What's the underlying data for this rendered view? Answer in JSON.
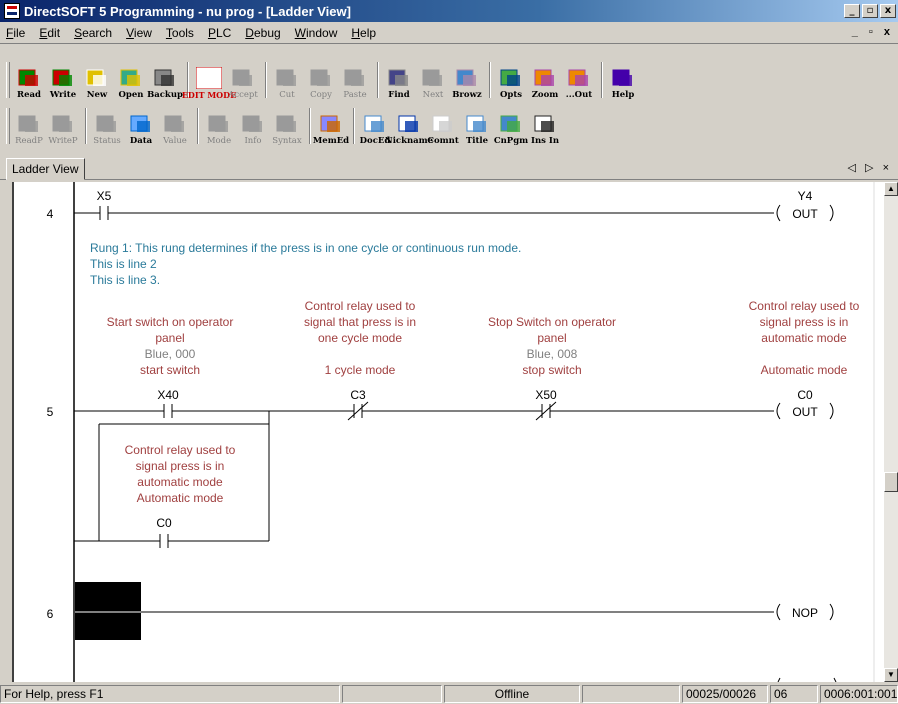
{
  "window": {
    "title": "DirectSOFT 5 Programming - nu prog - [Ladder View]",
    "min": "_",
    "max": "▫",
    "close": "x"
  },
  "menu": [
    "File",
    "Edit",
    "Search",
    "View",
    "Tools",
    "PLC",
    "Debug",
    "Window",
    "Help"
  ],
  "menu_underline": [
    "F",
    "E",
    "S",
    "V",
    "T",
    "P",
    "D",
    "W",
    "H"
  ],
  "mdi_controls": "_ ▫ x",
  "toolbar1": [
    {
      "label": "Read",
      "icon": "read-icon"
    },
    {
      "label": "Write",
      "icon": "write-icon"
    },
    {
      "label": "New",
      "icon": "new-icon"
    },
    {
      "label": "Open",
      "icon": "open-icon"
    },
    {
      "label": "Backup",
      "icon": "backup-icon"
    },
    {
      "label": "EDIT MODE",
      "icon": "edit-mode-icon"
    },
    {
      "label": "Accept",
      "icon": "accept-icon",
      "disabled": true
    },
    {
      "label": "Cut",
      "icon": "cut-icon",
      "disabled": true
    },
    {
      "label": "Copy",
      "icon": "copy-icon",
      "disabled": true
    },
    {
      "label": "Paste",
      "icon": "paste-icon",
      "disabled": true
    },
    {
      "label": "Find",
      "icon": "find-icon"
    },
    {
      "label": "Next",
      "icon": "next-icon",
      "disabled": true
    },
    {
      "label": "Browz",
      "icon": "browse-icon"
    },
    {
      "label": "Opts",
      "icon": "options-icon"
    },
    {
      "label": "Zoom",
      "icon": "zoom-icon"
    },
    {
      "label": "...Out",
      "icon": "zoom-out-icon"
    },
    {
      "label": "Help",
      "icon": "help-icon"
    }
  ],
  "toolbar2": [
    {
      "label": "ReadP",
      "icon": "read-plc-icon",
      "disabled": true
    },
    {
      "label": "WriteP",
      "icon": "write-plc-icon",
      "disabled": true
    },
    {
      "label": "Status",
      "icon": "status-icon",
      "disabled": true
    },
    {
      "label": "Data",
      "icon": "data-icon"
    },
    {
      "label": "Value",
      "icon": "value-icon",
      "disabled": true
    },
    {
      "label": "Mode",
      "icon": "mode-icon",
      "disabled": true
    },
    {
      "label": "Info",
      "icon": "info-icon",
      "disabled": true
    },
    {
      "label": "Syntax",
      "icon": "syntax-icon",
      "disabled": true
    },
    {
      "label": "MemEd",
      "icon": "memory-editor-icon"
    },
    {
      "label": "DocEd",
      "icon": "doc-editor-icon"
    },
    {
      "label": "Nickname",
      "icon": "nickname-icon"
    },
    {
      "label": "Comnt",
      "icon": "comment-icon"
    },
    {
      "label": "Title",
      "icon": "title-icon"
    },
    {
      "label": "CnPgm",
      "icon": "cnpgm-icon"
    },
    {
      "label": "Ins In",
      "icon": "insert-instruction-icon"
    }
  ],
  "tab": {
    "label": "Ladder View",
    "nav": "◁ ▷ ×"
  },
  "ladder": {
    "rung4": {
      "number": "4",
      "contact": "X5",
      "coil": "Y4",
      "coil_type": "OUT"
    },
    "comment_lines": [
      "Rung 1: This rung determines if the press is in one cycle or continuous run mode.",
      "This is line 2",
      "This is line 3."
    ],
    "rung5": {
      "number": "5",
      "c1": {
        "doc": [
          "Start switch on operator",
          "panel"
        ],
        "wiring": "Blue, 000",
        "nickname": "start switch",
        "addr": "X40"
      },
      "c2": {
        "doc": [
          "Control relay used to",
          "signal that press is in",
          "one cycle mode"
        ],
        "nickname": "1 cycle mode",
        "addr": "C3"
      },
      "c3": {
        "doc": [
          "Stop Switch on operator",
          "panel"
        ],
        "wiring": "Blue, 008",
        "nickname": "stop switch",
        "addr": "X50"
      },
      "coil": {
        "doc": [
          "Control relay used to",
          "signal press is in",
          "automatic mode"
        ],
        "nickname": "Automatic mode",
        "addr": "C0",
        "type": "OUT"
      },
      "branch": {
        "doc": [
          "Control relay used to",
          "signal press is in",
          "automatic mode"
        ],
        "nickname": "Automatic mode",
        "addr": "C0"
      }
    },
    "rung6": {
      "number": "6",
      "coil_type": "NOP"
    }
  },
  "status": {
    "help": "For Help, press F1",
    "mode": "Offline",
    "position": "00025/00026",
    "col": "06",
    "addr": "0006:001:001"
  },
  "colors": {
    "doc": "#a04040",
    "comment": "#2a7a9a",
    "wiring": "#808080",
    "titlebar": "#0a246a"
  }
}
